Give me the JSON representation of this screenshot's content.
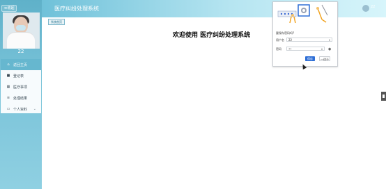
{
  "app": {
    "title": "医疗纠纷处理系统",
    "collapse_button_label": "≪收起",
    "username": "22"
  },
  "sidebar": {
    "username": "22",
    "menu": [
      {
        "label": "返回主页",
        "icon": "home-icon",
        "active": true
      },
      {
        "label": "登记表",
        "icon": "square-icon"
      },
      {
        "label": "医疗事项",
        "icon": "grid-icon"
      },
      {
        "label": "处理结果",
        "icon": "list-icon"
      },
      {
        "label": "个人资料",
        "icon": "folder-icon",
        "has_submenu": true
      }
    ]
  },
  "content": {
    "breadcrumb": "系统首页",
    "welcome": "欢迎使用 医疗纠纷处理系统"
  },
  "modal": {
    "question": "要保存密码吗?",
    "fields": [
      {
        "label": "用户名",
        "value": "22"
      },
      {
        "label": "密码",
        "value": "••"
      }
    ],
    "primary_button": "保存",
    "secondary_button": "一律不"
  },
  "colors": {
    "sidebar": "#78c2d8",
    "header_start": "#6fc1d9",
    "header_end": "#d7f5fb",
    "menu_active": "#66b7cf",
    "primary_button": "#2f6fd6"
  }
}
